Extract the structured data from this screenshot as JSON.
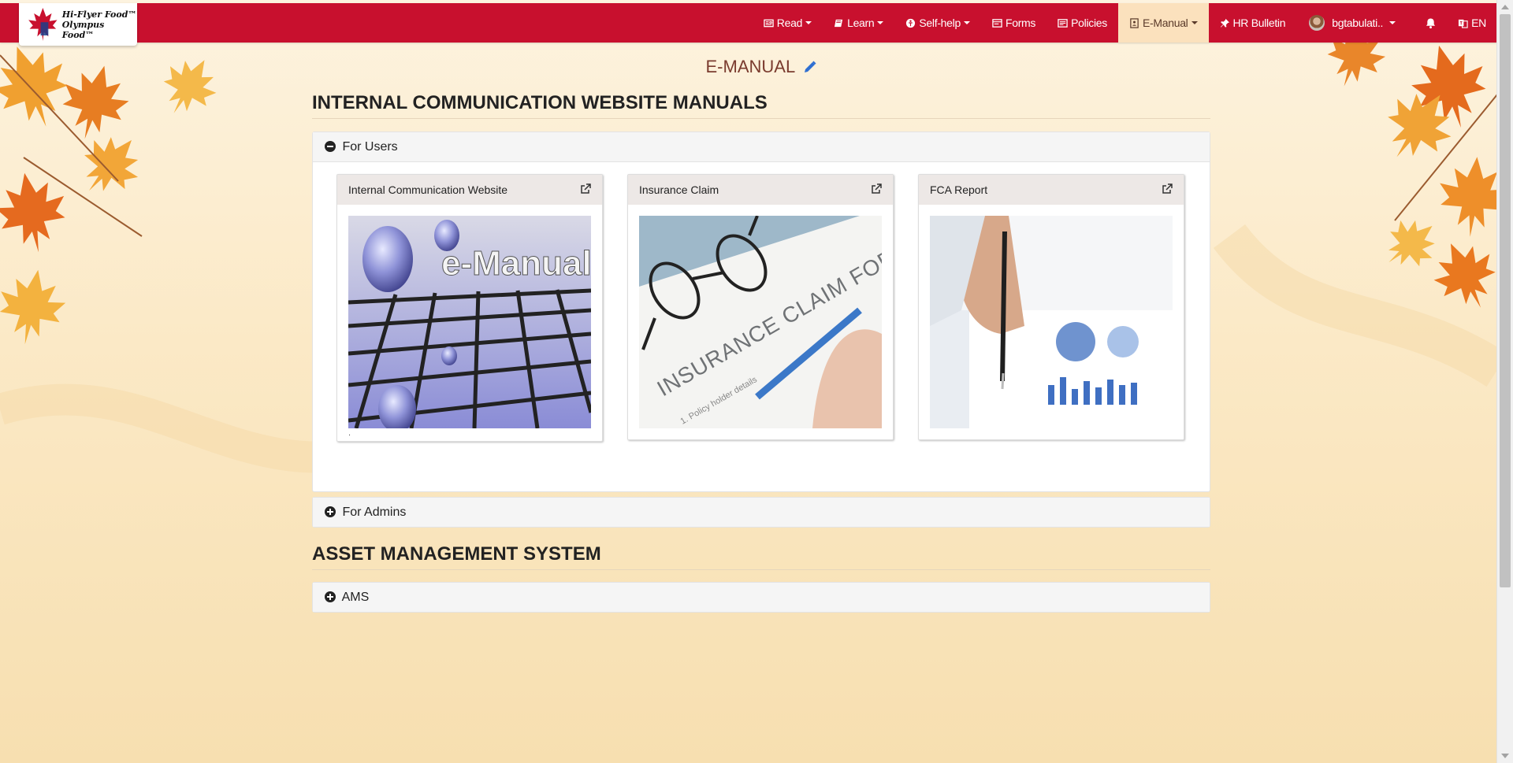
{
  "brand": {
    "logo_line1": "Hi-Flyer Food™",
    "logo_line2": "Olympus Food™"
  },
  "nav": {
    "read": "Read",
    "learn": "Learn",
    "selfhelp": "Self-help",
    "forms": "Forms",
    "policies": "Policies",
    "emanual": "E-Manual",
    "hr_bulletin": "HR Bulletin",
    "user": "bgtabulati..",
    "lang": "EN"
  },
  "page": {
    "title": "E-MANUAL"
  },
  "sections": {
    "s1_title": "INTERNAL COMMUNICATION WEBSITE MANUALS",
    "for_users": "For Users",
    "for_admins": "For Admins",
    "s2_title": "ASSET MANAGEMENT SYSTEM",
    "ams": "AMS"
  },
  "cards": [
    {
      "title": "Internal Communication Website",
      "image_text": "e-Manual",
      "caption": "."
    },
    {
      "title": "Insurance Claim",
      "image_text": "INSURANCE CLAIM FORM",
      "image_subtext": "1. Policy holder details"
    },
    {
      "title": "FCA Report"
    }
  ],
  "colors": {
    "navbar": "#c8102e",
    "active_nav": "#fbe1bd",
    "page_title": "#7a3b2e",
    "background": "#fbe9c6"
  },
  "icons": [
    "newspaper-icon",
    "book-icon",
    "life-ring-icon",
    "form-icon",
    "policy-icon",
    "manual-icon",
    "pin-icon",
    "bell-icon",
    "language-icon",
    "pencil-icon",
    "minus-circle-icon",
    "plus-circle-icon",
    "external-link-icon"
  ]
}
